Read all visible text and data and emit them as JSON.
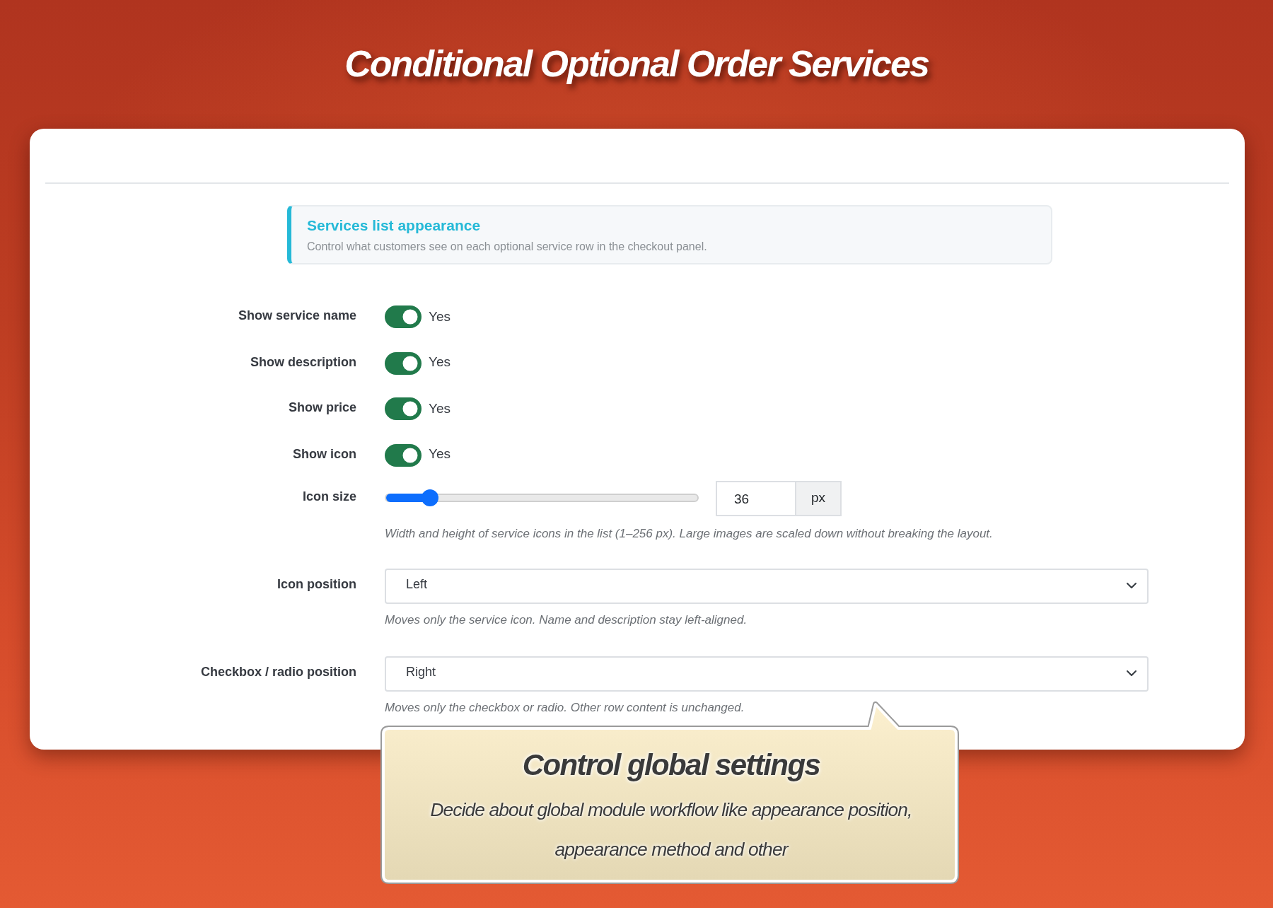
{
  "title": "Conditional Optional Order Services",
  "panel": {
    "info": {
      "title": "Services list appearance",
      "text": "Control what customers see on each optional service row in the checkout panel."
    },
    "settings": [
      {
        "kind": "switch",
        "label": "Show service name",
        "on": true,
        "value_label": "Yes"
      },
      {
        "kind": "switch",
        "label": "Show description",
        "on": true,
        "value_label": "Yes"
      },
      {
        "kind": "switch",
        "label": "Show price",
        "on": true,
        "value_label": "Yes"
      },
      {
        "kind": "switch",
        "label": "Show icon",
        "on": true,
        "value_label": "Yes"
      },
      {
        "kind": "slider",
        "label": "Icon size",
        "level": 0.14,
        "value": "36",
        "unit": "px",
        "help": "Width and height of service icons in the list (1–256 px). Large images are scaled down without breaking the layout."
      },
      {
        "kind": "select",
        "label": "Icon position",
        "value": "Left",
        "help": "Moves only the service icon. Name and description stay left-aligned."
      },
      {
        "kind": "select",
        "label": "Checkbox / radio position",
        "value": "Right",
        "help": "Moves only the checkbox or radio. Other row content is unchanged."
      }
    ]
  },
  "callout": {
    "title": "Control global settings",
    "text": "Decide about global module workflow like appearance position, appearance method and other"
  }
}
